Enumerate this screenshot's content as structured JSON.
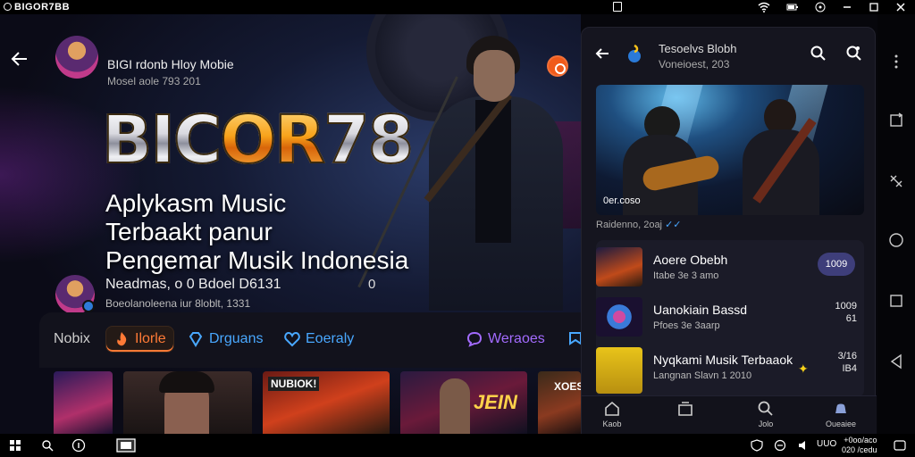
{
  "window": {
    "title": "BIGOR7BB"
  },
  "header": {
    "title": "BIGI rdonb Hloy Mobie",
    "subtitle": "Mosel aole 793 201"
  },
  "hero": {
    "logo_main": "BIC",
    "logo_accent": "OR",
    "logo_end": "78",
    "tagline": [
      "Aplykasm Music",
      "Terbaakt panur",
      "Pengemar Musik Indonesia"
    ]
  },
  "author": {
    "name": "Neadmas, o 0 Bdoel D6131",
    "subtitle": "Boeolanoleena iur 8loblt, 1331",
    "icon_text": "0"
  },
  "categories": [
    {
      "label": "Nobix",
      "icon": "none"
    },
    {
      "label": "Ilorle",
      "icon": "fire-icon",
      "active": true
    },
    {
      "label": "Drguans",
      "icon": "diamond-icon"
    },
    {
      "label": "Eoeraly",
      "icon": "heart-icon"
    },
    {
      "label": "Weraoes",
      "icon": "chat-icon"
    }
  ],
  "thumbnails": [
    {
      "label": ""
    },
    {
      "label": ""
    },
    {
      "label": "NUBIOK!"
    },
    {
      "label": "JEIN"
    },
    {
      "label": "XOES"
    }
  ],
  "panel": {
    "title": "Tesoelvs Blobh",
    "subtitle": "Voneioest, 203",
    "hero_count": "0er.coso",
    "hero_meta": "Raidenno, 2oaj",
    "list": [
      {
        "name": "Aoere Obebh",
        "sub": "Itabe 3e 3 amo",
        "badge": "1009"
      },
      {
        "name": "Uanokiain Bassd",
        "sub": "Pfoes 3e 3aarp",
        "right1": "1009",
        "right2": "61"
      },
      {
        "name": "Nyqkami Musik Terbaaok",
        "sub": "Langnan Slavn 1 2010",
        "right1": "3/16",
        "right2": "IB4"
      }
    ],
    "nav": [
      {
        "label": "Kaob",
        "icon": "home-icon"
      },
      {
        "label": "",
        "icon": "library-icon"
      },
      {
        "label": "Jolo",
        "icon": "search-icon"
      },
      {
        "label": "Oueaiee",
        "icon": "bell-icon"
      }
    ]
  },
  "taskbar": {
    "clock": "+0oo/aco",
    "date": "020 /cedu",
    "tray_text": "UUO"
  },
  "colors": {
    "accent": "#ff7a36",
    "cyan": "#49a8ff",
    "purple": "#a36bff",
    "panel": "#15151f"
  }
}
